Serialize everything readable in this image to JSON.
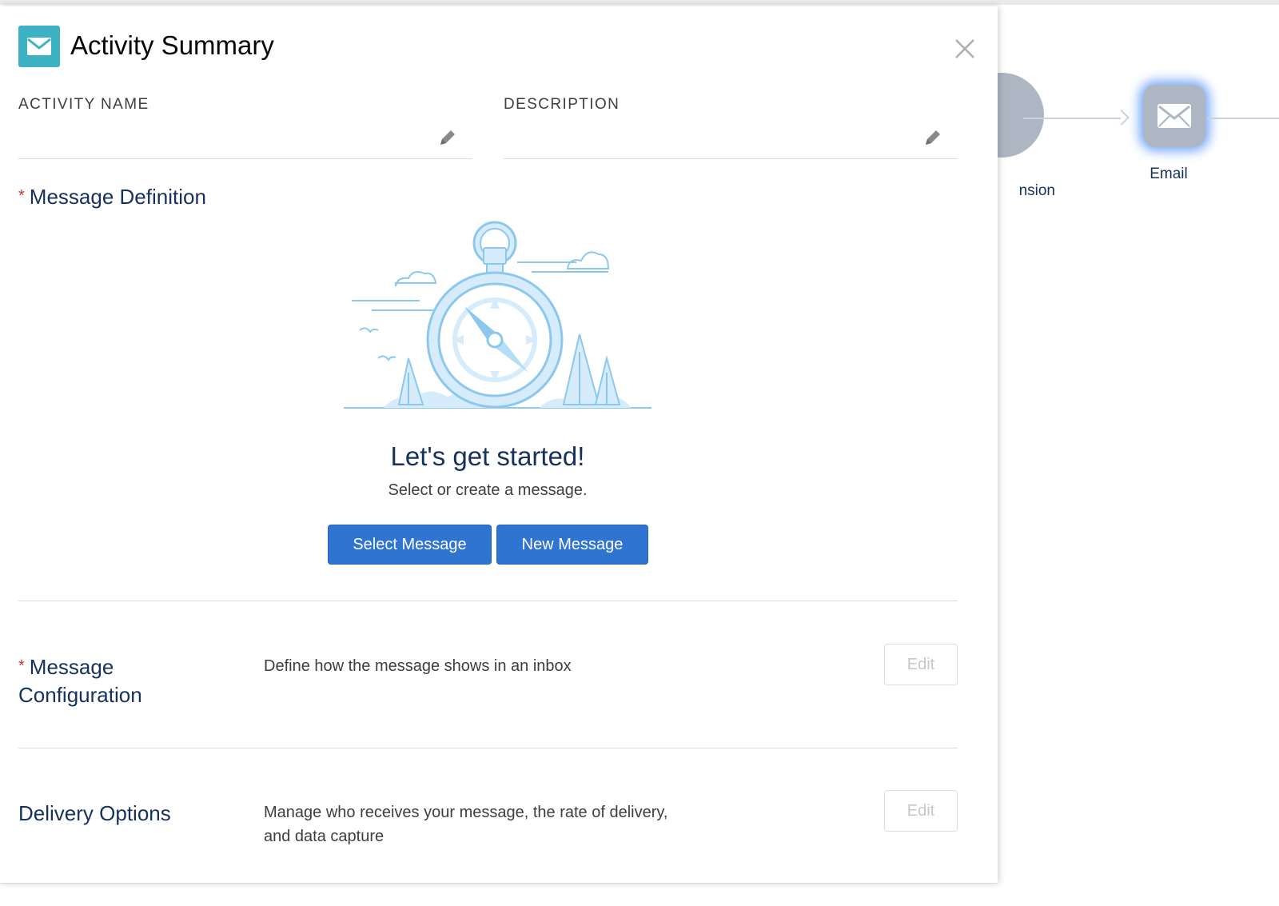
{
  "panel": {
    "title": "Activity Summary",
    "icon": "email-icon",
    "accent_color": "#3cb2c4"
  },
  "fields": {
    "activity_name_label": "ACTIVITY NAME",
    "description_label": "DESCRIPTION"
  },
  "message_definition": {
    "title": "Message Definition",
    "required": "*",
    "hero_title": "Let's get started!",
    "hero_subtitle": "Select or create a message.",
    "select_button": "Select Message",
    "new_button": "New Message",
    "button_color": "#2f74d0"
  },
  "message_configuration": {
    "required": "*",
    "title_line1": "Message",
    "title_line2": "Configuration",
    "description": "Define how the message shows in an inbox",
    "edit_button": "Edit"
  },
  "delivery_options": {
    "title": "Delivery Options",
    "description_line1": "Manage who receives your message, the rate of delivery,",
    "description_line2": "and data capture",
    "edit_button": "Edit"
  },
  "canvas": {
    "partial_node_label": "nsion",
    "email_node_label": "Email",
    "email_node_glow": "#4888f6"
  }
}
